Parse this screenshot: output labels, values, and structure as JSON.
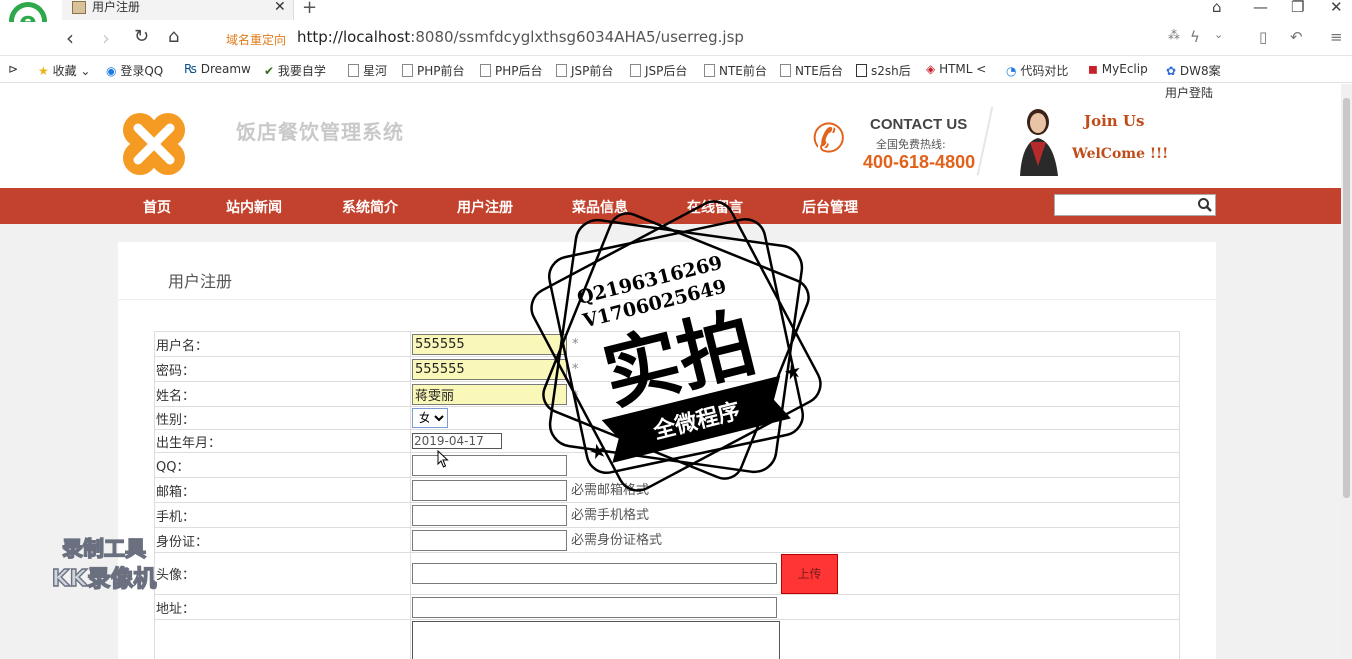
{
  "browser": {
    "tab_title": "用户注册",
    "redirect_label": "域名重定向",
    "url_host": "http://localhost",
    "url_rest": ":8080/ssmfdcyglxthsg6034AHA5/userreg.jsp",
    "bookmarks": [
      "收藏",
      "登录QQ",
      "Dreamw",
      "我要自学",
      "星河",
      "PHP前台",
      "PHP后台",
      "JSP前台",
      "JSP后台",
      "NTE前台",
      "NTE后台",
      "s2sh后",
      "HTML <",
      "代码对比",
      "MyEclip",
      "DW8案"
    ]
  },
  "header": {
    "login_link": "用户登陆",
    "site_title": "饭店餐饮管理系统",
    "contact_label": "CONTACT US",
    "hotline_label": "全国免费热线:",
    "phone": "400-618-4800",
    "join_title": "Join Us",
    "join_welcome": "WelCome !!!"
  },
  "nav": {
    "items": [
      "首页",
      "站内新闻",
      "系统简介",
      "用户注册",
      "菜品信息",
      "在线留言",
      "后台管理"
    ]
  },
  "form": {
    "title": "用户注册",
    "fields": {
      "username": {
        "label": "用户名：",
        "value": "555555",
        "required": "*"
      },
      "password": {
        "label": "密码：",
        "value": "555555",
        "required": "*"
      },
      "name": {
        "label": "姓名：",
        "value": "蒋雯丽",
        "required": "*"
      },
      "gender": {
        "label": "性别：",
        "value": "女"
      },
      "birthday": {
        "label": "出生年月：",
        "value": "2019-04-17"
      },
      "qq": {
        "label": "QQ：",
        "value": ""
      },
      "email": {
        "label": "邮箱：",
        "value": "",
        "hint": "必需邮箱格式"
      },
      "mobile": {
        "label": "手机：",
        "value": "",
        "hint": "必需手机格式"
      },
      "idcard": {
        "label": "身份证：",
        "value": "",
        "hint": "必需身份证格式"
      },
      "avatar": {
        "label": "头像：",
        "value": "",
        "button": "上传"
      },
      "address": {
        "label": "地址：",
        "value": ""
      }
    }
  },
  "stamp": {
    "line1": "Q2196316269",
    "line2": "V1706025649",
    "big": "实拍",
    "ribbon": "全微程序"
  },
  "watermark": {
    "line1": "录制工具",
    "line2": "KK录像机"
  }
}
